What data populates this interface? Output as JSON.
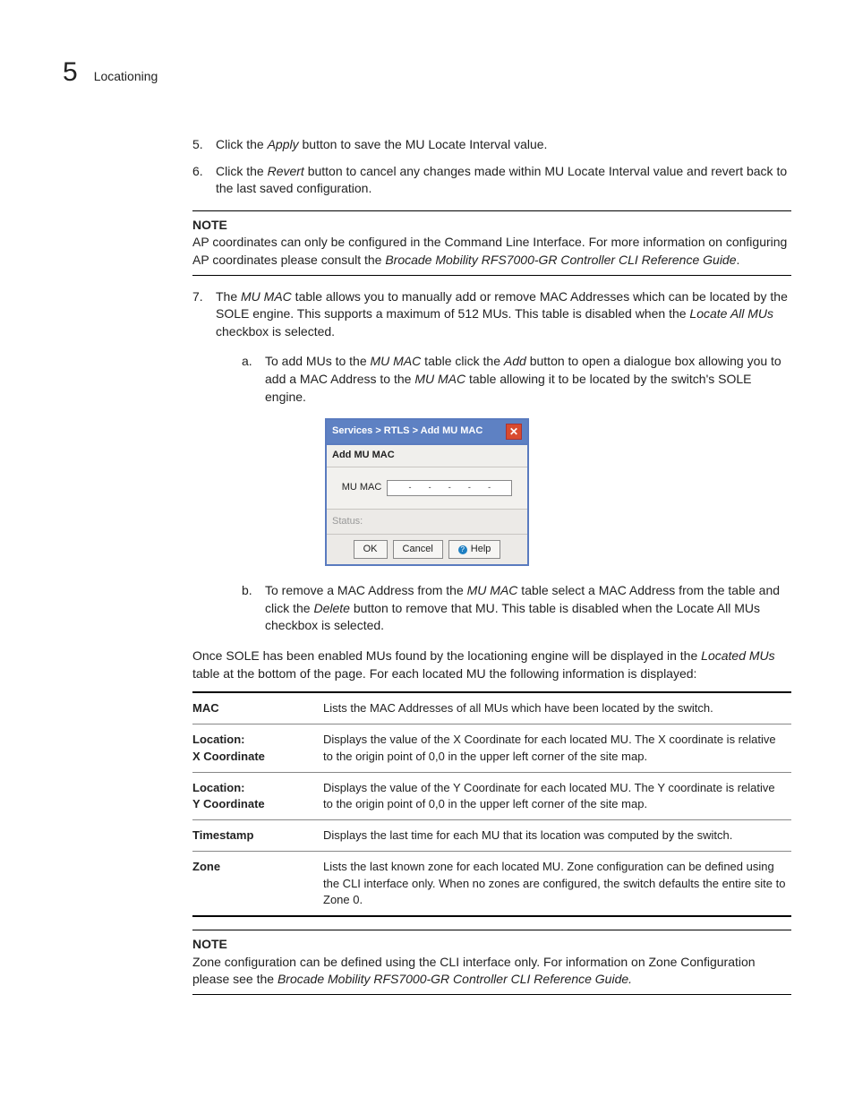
{
  "header": {
    "chapter_number": "5",
    "chapter_title": "Locationing"
  },
  "steps": {
    "s5": {
      "num": "5.",
      "text_pre": "Click the ",
      "em1": "Apply",
      "text_post": " button to save the MU Locate Interval value."
    },
    "s6": {
      "num": "6.",
      "text_pre": "Click the ",
      "em1": "Revert",
      "text_post": " button to cancel any changes made within MU Locate Interval value and revert back to the last saved configuration."
    }
  },
  "note1": {
    "label": "NOTE",
    "text_pre": "AP coordinates can only be configured in the Command Line Interface. For more information on configuring AP coordinates please consult the ",
    "em1": "Brocade Mobility RFS7000-GR Controller CLI Reference Guide",
    "text_post": "."
  },
  "step7": {
    "num": "7.",
    "t1": "The ",
    "em1": "MU MAC",
    "t2": " table allows you to manually add or remove MAC Addresses which can be located by the SOLE engine. This supports a maximum of 512 MUs. This table is disabled when the ",
    "em2": "Locate All MUs",
    "t3": " checkbox is selected."
  },
  "sub_a": {
    "num": "a.",
    "t1": "To add MUs to the ",
    "em1": "MU MAC",
    "t2": " table click the ",
    "em2": "Add",
    "t3": " button to open a dialogue box allowing you to add a MAC Address to the ",
    "em3": "MU MAC",
    "t4": " table allowing it to be located by the switch's SOLE engine."
  },
  "sub_b": {
    "num": "b.",
    "t1": "To remove a MAC Address from the ",
    "em1": "MU MAC",
    "t2": " table select a MAC Address from the table and click the ",
    "em2": "Delete",
    "t3": " button to remove that MU. This table is disabled when the Locate All MUs checkbox is selected."
  },
  "para_once": {
    "t1": "Once SOLE has been enabled MUs found by the locationing engine will be displayed in the ",
    "em1": "Located MUs",
    "t2": " table at the bottom of the page. For each located MU the following information is displayed:"
  },
  "table": {
    "rows": [
      {
        "term": "MAC",
        "desc": "Lists the MAC Addresses of all MUs which have been located by the switch."
      },
      {
        "term": "Location:\nX Coordinate",
        "desc": "Displays the value of the X Coordinate for each located MU. The X coordinate is relative to the origin point of 0,0 in the upper left corner of the site map."
      },
      {
        "term": "Location:\nY Coordinate",
        "desc": "Displays the value of the Y Coordinate for each located MU. The Y coordinate is relative to the origin point of 0,0 in the upper left corner of the site map."
      },
      {
        "term": "Timestamp",
        "desc": "Displays the last time for each MU that its location was computed by the switch."
      },
      {
        "term": "Zone",
        "desc": "Lists the last known zone for each located MU. Zone configuration can be defined using the CLI interface only. When no zones are configured, the switch defaults the entire site to Zone 0."
      }
    ]
  },
  "note2": {
    "label": "NOTE",
    "t1": "Zone configuration can be defined using the CLI interface only. For information on Zone Configuration please see the ",
    "em1": "Brocade Mobility RFS7000-GR Controller CLI Reference Guide.",
    "t2": ""
  },
  "dialog": {
    "title": "Services  >  RTLS  >  Add MU MAC",
    "section": "Add MU MAC",
    "field_label": "MU MAC",
    "status_label": "Status:",
    "ok": "OK",
    "cancel": "Cancel",
    "help": "Help"
  }
}
